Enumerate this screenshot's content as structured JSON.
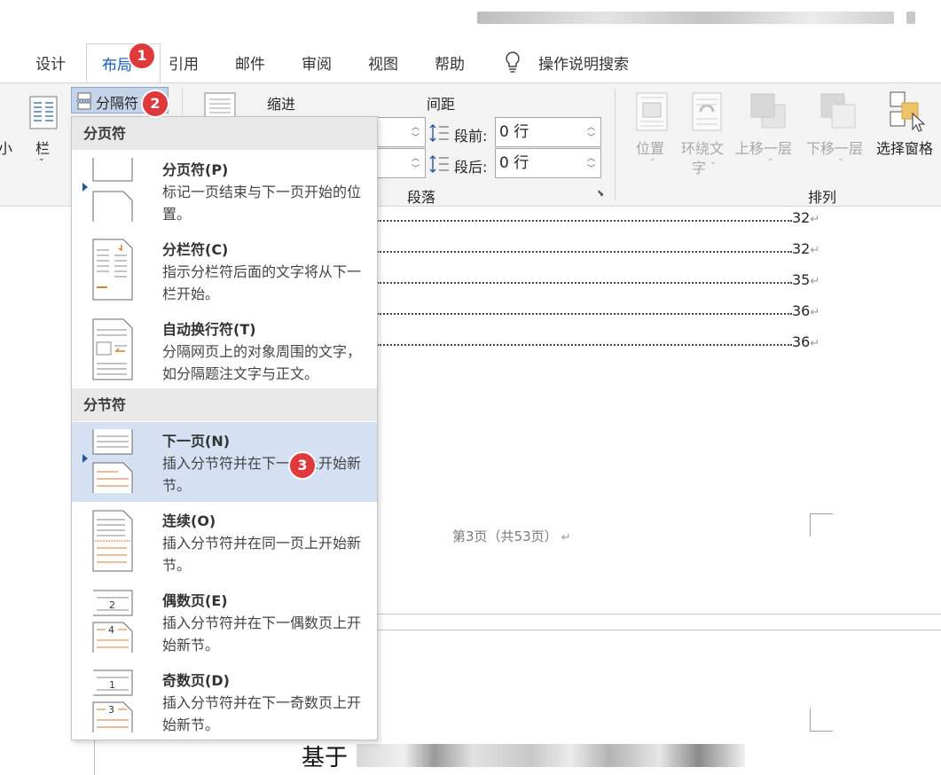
{
  "tabs": [
    "设计",
    "布局",
    "引用",
    "邮件",
    "审阅",
    "视图",
    "帮助",
    "操作说明搜索"
  ],
  "ribbon": {
    "breaks_label": "分隔符",
    "left_small": "小",
    "columns_label": "栏",
    "indent_label": "缩进",
    "spacing_label": "间距",
    "before_label": "段前:",
    "before_value": "0 行",
    "after_label": "段后:",
    "after_value": "0 行",
    "paragraph_group": "段落",
    "arrange_group": "排列",
    "position_label": "位置",
    "wrap_text_line1": "环绕文",
    "wrap_text_line2": "字",
    "bring_forward": "上移一层",
    "send_backward": "下移一层",
    "selection_pane": "选择窗格"
  },
  "dropdown": {
    "page_breaks_header": "分页符",
    "section_breaks_header": "分节符",
    "items": [
      {
        "title": "分页符(P)",
        "desc": "标记一页结束与下一页开始的位置。"
      },
      {
        "title": "分栏符(C)",
        "desc": "指示分栏符后面的文字将从下一栏开始。"
      },
      {
        "title": "自动换行符(T)",
        "desc": "分隔网页上的对象周围的文字，如分隔题注文字与正文。"
      },
      {
        "title": "下一页(N)",
        "desc": "插入分节符并在下一页上开始新节。"
      },
      {
        "title": "连续(O)",
        "desc": "插入分节符并在同一页上开始新节。"
      },
      {
        "title": "偶数页(E)",
        "desc": "插入分节符并在下一偶数页上开始新节。"
      },
      {
        "title": "奇数页(D)",
        "desc": "插入分节符并在下一奇数页上开始新节。"
      }
    ]
  },
  "document": {
    "toc_numbers": [
      "32",
      "32",
      "35",
      "36",
      "36"
    ],
    "page_footer": "第3页（共53页）",
    "next_page_heading_visible": "基于"
  },
  "badges": [
    "1",
    "2",
    "3"
  ],
  "colors": {
    "accent": "#185abd",
    "highlight": "#d5e1f2",
    "badge": "#e0393c",
    "icon_orange": "#e07a2f"
  }
}
